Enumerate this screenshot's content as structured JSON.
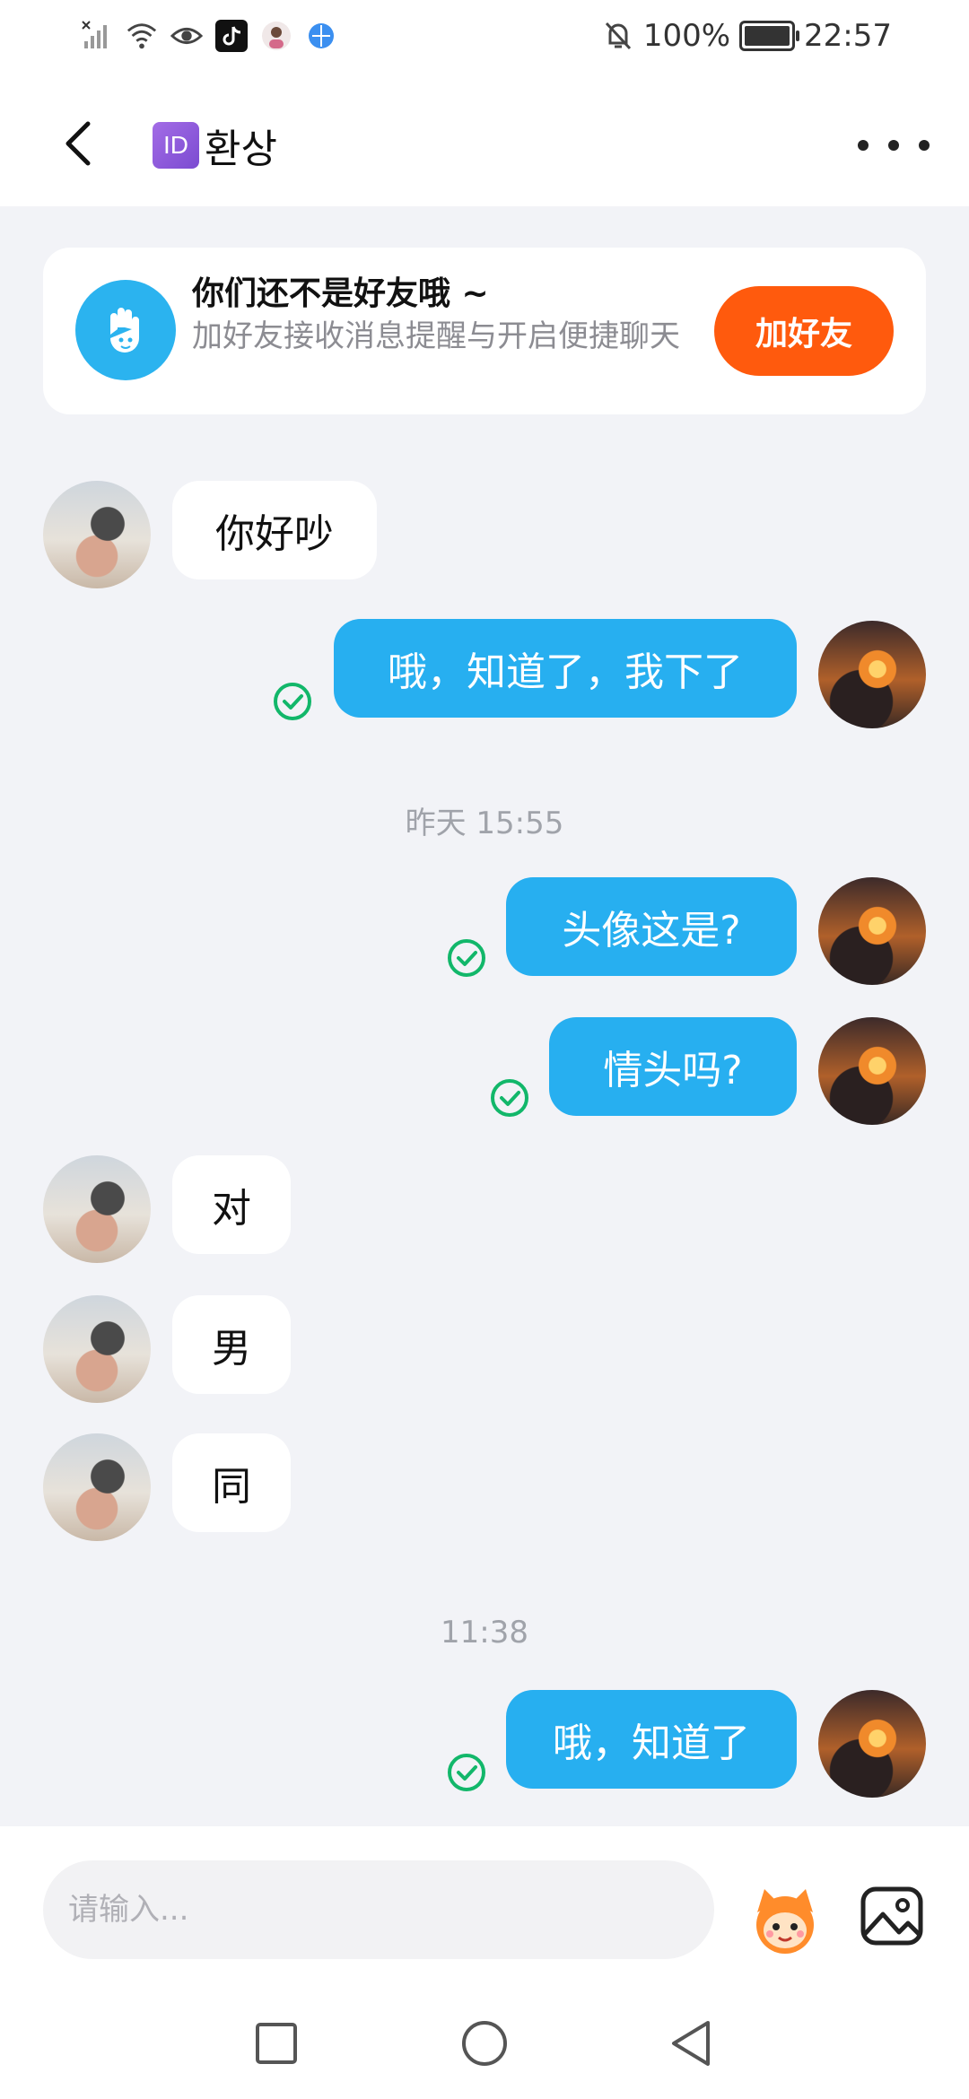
{
  "status_bar": {
    "battery": "100%",
    "time": "22:57"
  },
  "header": {
    "id_badge": "ID",
    "title": "환상"
  },
  "banner": {
    "title": "你们还不是好友哦 ~",
    "subtitle": "加好友接收消息提醒与开启便捷聊天",
    "button": "加好友"
  },
  "messages": [
    {
      "side": "left",
      "text": "你好吵"
    },
    {
      "side": "right",
      "text": "哦，知道了，我下了"
    },
    {
      "side": "right",
      "text": "头像这是?"
    },
    {
      "side": "right",
      "text": "情头吗?"
    },
    {
      "side": "left",
      "text": "对"
    },
    {
      "side": "left",
      "text": "男"
    },
    {
      "side": "left",
      "text": "同"
    },
    {
      "side": "right",
      "text": "哦，知道了"
    }
  ],
  "timestamps": [
    "昨天 15:55",
    "11:38"
  ],
  "input": {
    "placeholder": "请输入..."
  },
  "colors": {
    "bubble_right": "#27aff0",
    "add_button": "#ff5a0d",
    "banner_icon": "#2bb3ef",
    "check": "#12b76a"
  }
}
